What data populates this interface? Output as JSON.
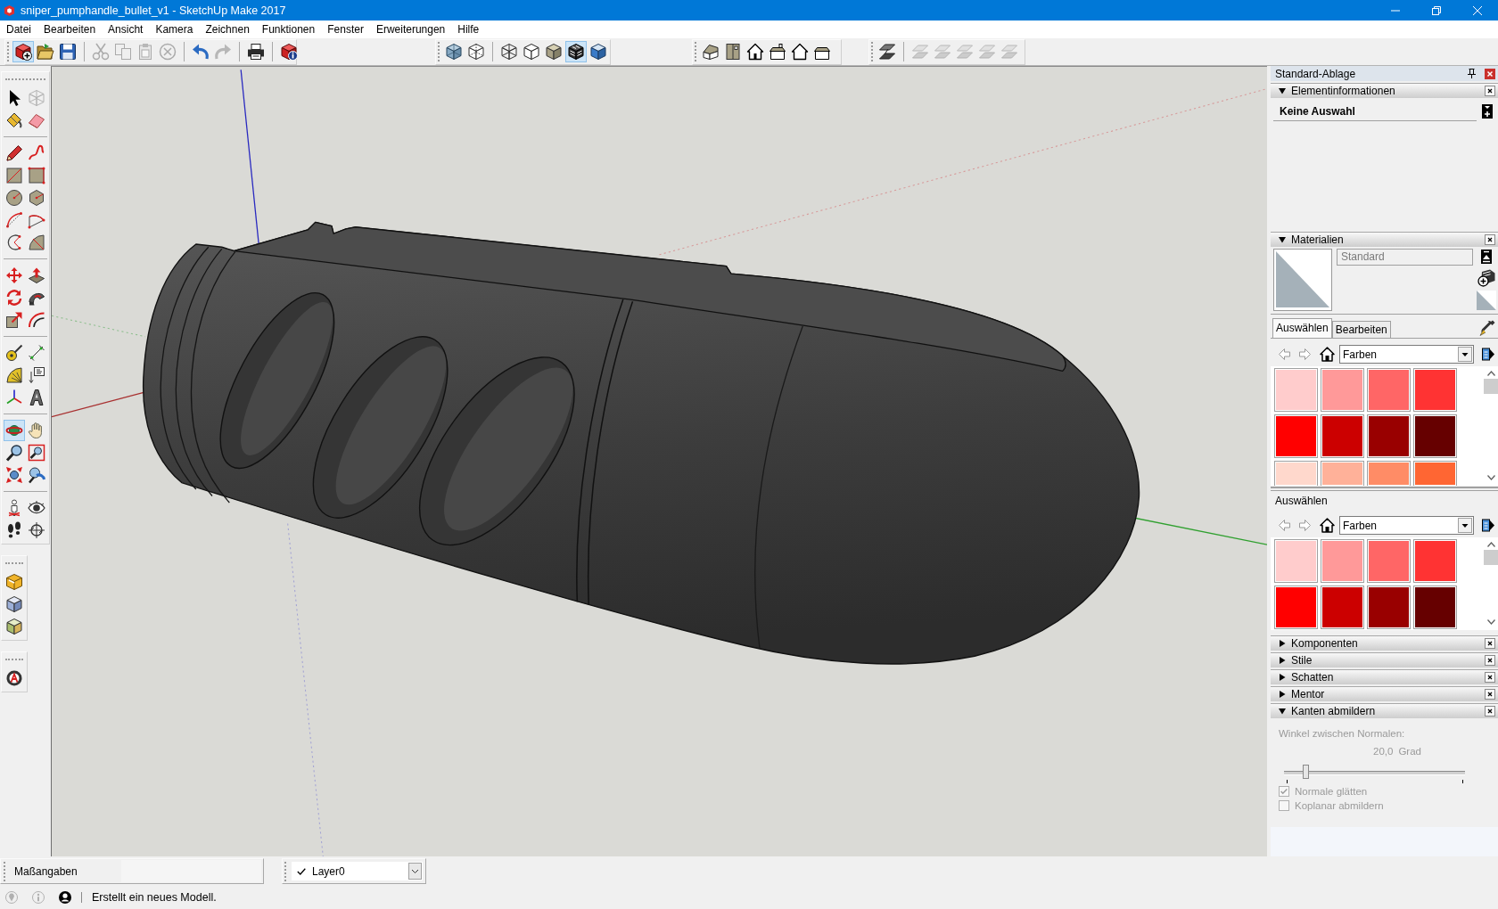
{
  "window": {
    "title": "sniper_pumphandle_bullet_v1 - SketchUp Make 2017"
  },
  "menu": [
    "Datei",
    "Bearbeiten",
    "Ansicht",
    "Kamera",
    "Zeichnen",
    "Funktionen",
    "Fenster",
    "Erweiterungen",
    "Hilfe"
  ],
  "toolbars": [
    {
      "groups": [
        [
          {
            "kind": "new",
            "selected": true,
            "disabled": false
          },
          {
            "kind": "open",
            "selected": false,
            "disabled": false
          },
          {
            "kind": "save",
            "selected": false,
            "disabled": false
          }
        ],
        [
          {
            "kind": "cut",
            "selected": false,
            "disabled": true
          },
          {
            "kind": "copy",
            "selected": false,
            "disabled": true
          },
          {
            "kind": "paste",
            "selected": false,
            "disabled": true
          },
          {
            "kind": "erase",
            "selected": false,
            "disabled": true
          }
        ],
        [
          {
            "kind": "undo",
            "selected": false,
            "disabled": false
          },
          {
            "kind": "redo",
            "selected": false,
            "disabled": true
          }
        ],
        [
          {
            "kind": "print",
            "selected": false,
            "disabled": false
          }
        ],
        [
          {
            "kind": "info",
            "selected": false,
            "disabled": false
          }
        ]
      ]
    },
    {
      "groups": [
        [
          {
            "kind": "xray",
            "selected": false,
            "disabled": false
          },
          {
            "kind": "backedges",
            "selected": false,
            "disabled": false
          }
        ],
        [
          {
            "kind": "wireframe",
            "selected": false,
            "disabled": false
          },
          {
            "kind": "hiddenline",
            "selected": false,
            "disabled": false
          },
          {
            "kind": "shaded",
            "selected": false,
            "disabled": false
          },
          {
            "kind": "textured",
            "selected": true,
            "disabled": false
          },
          {
            "kind": "mono",
            "selected": false,
            "disabled": false
          }
        ]
      ]
    },
    {
      "groups": [
        [
          {
            "kind": "iso",
            "selected": false,
            "disabled": false
          },
          {
            "kind": "top",
            "selected": false,
            "disabled": false
          },
          {
            "kind": "front",
            "selected": false,
            "disabled": false
          },
          {
            "kind": "right",
            "selected": false,
            "disabled": false
          },
          {
            "kind": "back",
            "selected": false,
            "disabled": false
          },
          {
            "kind": "left",
            "selected": false,
            "disabled": false
          }
        ]
      ]
    },
    {
      "groups": [
        [
          {
            "kind": "planes",
            "selected": false,
            "disabled": false
          }
        ],
        [
          {
            "kind": "sectionview",
            "selected": false,
            "disabled": true
          },
          {
            "kind": "sectionview",
            "selected": false,
            "disabled": true
          },
          {
            "kind": "sectionview",
            "selected": false,
            "disabled": true
          },
          {
            "kind": "sectionview",
            "selected": false,
            "disabled": true
          },
          {
            "kind": "sectionview",
            "selected": false,
            "disabled": true
          }
        ]
      ]
    }
  ],
  "tool_palettes": [
    {
      "groups": [
        [
          {
            "kind": "select",
            "selected": false,
            "disabled": false
          },
          {
            "kind": "component",
            "selected": false,
            "disabled": true
          },
          {
            "kind": "paint",
            "selected": false,
            "disabled": false
          },
          {
            "kind": "eraser",
            "selected": false,
            "disabled": false
          }
        ],
        [
          {
            "kind": "line",
            "selected": false,
            "disabled": false
          },
          {
            "kind": "freehand",
            "selected": false,
            "disabled": false
          },
          {
            "kind": "rectangle",
            "selected": false,
            "disabled": false
          },
          {
            "kind": "rotatedrectangle",
            "selected": false,
            "disabled": false
          },
          {
            "kind": "circle",
            "selected": false,
            "disabled": false
          },
          {
            "kind": "polygon",
            "selected": false,
            "disabled": false
          },
          {
            "kind": "arc",
            "selected": false,
            "disabled": false
          },
          {
            "kind": "twopointarc",
            "selected": false,
            "disabled": false
          },
          {
            "kind": "threepointarc",
            "selected": false,
            "disabled": false
          },
          {
            "kind": "pie",
            "selected": false,
            "disabled": false
          }
        ],
        [
          {
            "kind": "move",
            "selected": false,
            "disabled": false
          },
          {
            "kind": "pushpull",
            "selected": false,
            "disabled": false
          },
          {
            "kind": "rotate",
            "selected": false,
            "disabled": false
          },
          {
            "kind": "followme",
            "selected": false,
            "disabled": false
          },
          {
            "kind": "scale",
            "selected": false,
            "disabled": false
          },
          {
            "kind": "offset",
            "selected": false,
            "disabled": false
          }
        ],
        [
          {
            "kind": "tape",
            "selected": false,
            "disabled": false
          },
          {
            "kind": "dimension",
            "selected": false,
            "disabled": false
          },
          {
            "kind": "protractor",
            "selected": false,
            "disabled": false
          },
          {
            "kind": "text",
            "selected": false,
            "disabled": false
          },
          {
            "kind": "axes",
            "selected": false,
            "disabled": false
          },
          {
            "kind": "text3d",
            "selected": false,
            "disabled": false
          }
        ],
        [
          {
            "kind": "orbit",
            "selected": true,
            "disabled": false
          },
          {
            "kind": "pan",
            "selected": false,
            "disabled": false
          },
          {
            "kind": "zoom",
            "selected": false,
            "disabled": false
          },
          {
            "kind": "zoomwindow",
            "selected": false,
            "disabled": false
          },
          {
            "kind": "zoomextents",
            "selected": false,
            "disabled": false
          },
          {
            "kind": "previous",
            "selected": false,
            "disabled": false
          }
        ],
        [
          {
            "kind": "position",
            "selected": false,
            "disabled": false
          },
          {
            "kind": "lookaround",
            "selected": false,
            "disabled": false
          },
          {
            "kind": "walk",
            "selected": false,
            "disabled": false
          },
          {
            "kind": "section",
            "selected": false,
            "disabled": false
          }
        ]
      ]
    },
    {
      "groups": [
        [
          {
            "kind": "warehouse",
            "selected": false,
            "disabled": false
          },
          {
            "kind": "components",
            "selected": false,
            "disabled": false
          },
          {
            "kind": "extensions",
            "selected": false,
            "disabled": false
          }
        ]
      ]
    },
    {
      "groups": [
        [
          {
            "kind": "globe",
            "selected": false,
            "disabled": false
          }
        ]
      ]
    }
  ],
  "tray": {
    "title": "Standard-Ablage",
    "entity_info": {
      "title": "Elementinformationen",
      "expanded": true,
      "selection": "Keine Auswahl"
    },
    "materials": {
      "title": "Materialien",
      "expanded": true,
      "name_field": {
        "value": "Standard",
        "disabled": true
      },
      "tabs": [
        {
          "label": "Auswählen",
          "selected": true
        },
        {
          "label": "Bearbeiten",
          "selected": false
        }
      ],
      "library": "Farben",
      "swatches": [
        {
          "color": "#ffcccc"
        },
        {
          "color": "#ff9999"
        },
        {
          "color": "#ff6666"
        },
        {
          "color": "#ff3333"
        },
        {
          "color": "#ff0000"
        },
        {
          "color": "#cc0000"
        },
        {
          "color": "#990000"
        },
        {
          "color": "#660000"
        },
        {
          "color": "#ffd8cc"
        },
        {
          "color": "#ffb199"
        },
        {
          "color": "#ff8c66"
        },
        {
          "color": "#ff6633"
        }
      ],
      "secondary": {
        "label": "Auswählen",
        "library": "Farben",
        "swatches": [
          {
            "color": "#ffcccc"
          },
          {
            "color": "#ff9999"
          },
          {
            "color": "#ff6666"
          },
          {
            "color": "#ff3333"
          },
          {
            "color": "#ff0000"
          },
          {
            "color": "#cc0000"
          },
          {
            "color": "#990000"
          },
          {
            "color": "#660000"
          }
        ]
      }
    },
    "panels": [
      {
        "title": "Komponenten",
        "expanded": false
      },
      {
        "title": "Stile",
        "expanded": false
      },
      {
        "title": "Schatten",
        "expanded": false
      },
      {
        "title": "Mentor",
        "expanded": false
      }
    ],
    "soften_edges": {
      "title": "Kanten abmildern",
      "expanded": true,
      "disabled": true,
      "angle_label": "Winkel zwischen Normalen:",
      "angle_value": "20,0",
      "angle_unit": "Grad",
      "level": 0.12,
      "options": [
        {
          "label": "Normale glätten",
          "checked": true
        },
        {
          "label": "Koplanar abmildern",
          "checked": false
        }
      ]
    }
  },
  "measurements": {
    "label": "Maßangaben"
  },
  "layers": {
    "current": "Layer0",
    "visible": true
  },
  "status_bar": {
    "message": "Erstellt ein neues Modell."
  }
}
